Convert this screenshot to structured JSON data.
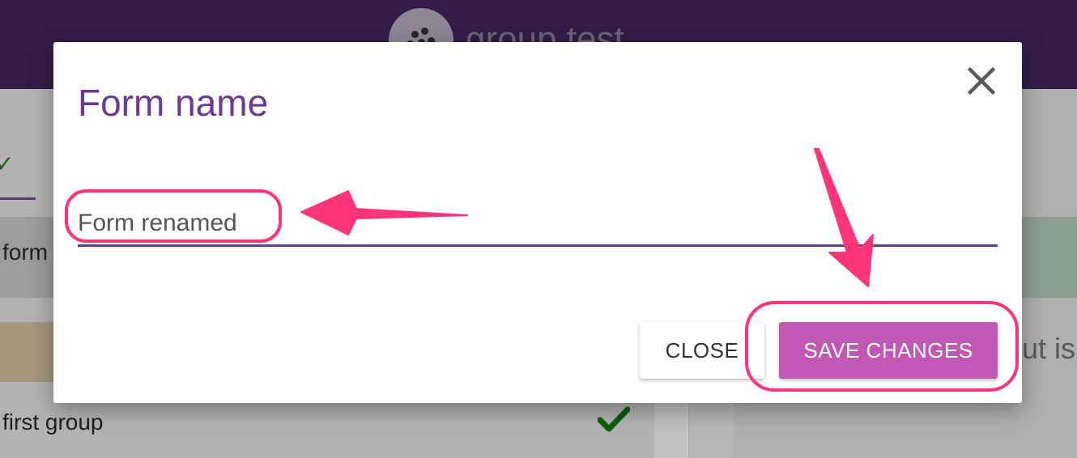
{
  "background": {
    "header_title": "group test",
    "left_rows": [
      "form",
      "first group"
    ],
    "right_text": "ut is"
  },
  "dialog": {
    "title": "Form name",
    "name_field_value": "Form renamed",
    "close_button_label": "CLOSE",
    "save_button_label": "SAVE CHANGES",
    "close_icon": "close-icon"
  },
  "annotations": {
    "highlight_color": "#ff3577",
    "arrow_icon": "arrow-icon"
  },
  "colors": {
    "header": "#341c48",
    "accent": "#6a3a96",
    "save_button": "#c158b4",
    "check": "#0b5e0b"
  }
}
